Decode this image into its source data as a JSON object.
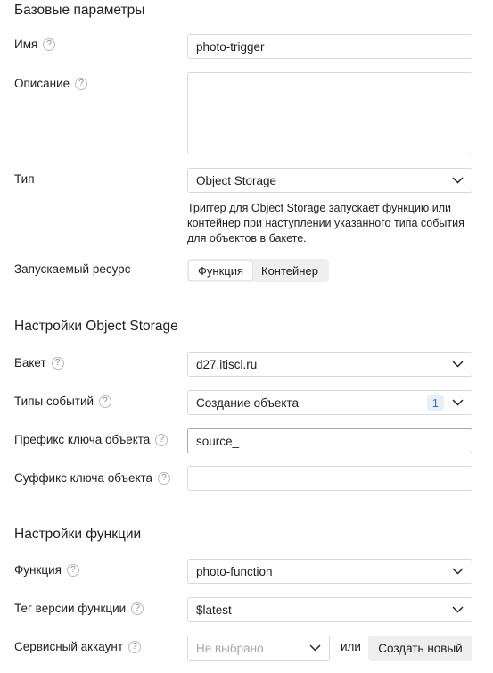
{
  "sections": {
    "basic": "Базовые параметры",
    "storage": "Настройки Object Storage",
    "function": "Настройки функции"
  },
  "help_glyph": "?",
  "name": {
    "label": "Имя",
    "value": "photo-trigger"
  },
  "description": {
    "label": "Описание",
    "value": ""
  },
  "type": {
    "label": "Тип",
    "value": "Object Storage",
    "hint": "Триггер для Object Storage запускает функцию или контейнер при наступлении указанного типа события для объектов в бакете."
  },
  "resource": {
    "label": "Запускаемый ресурс",
    "tabs": [
      "Функция",
      "Контейнер"
    ],
    "active_index": 0
  },
  "bucket": {
    "label": "Бакет",
    "value": "d27.itiscl.ru"
  },
  "event_types": {
    "label": "Типы событий",
    "value": "Создание объекта",
    "count": "1"
  },
  "prefix": {
    "label": "Префикс ключа объекта",
    "value": "source_"
  },
  "suffix": {
    "label": "Суффикс ключа объекта",
    "value": ""
  },
  "function": {
    "label": "Функция",
    "value": "photo-function"
  },
  "version_tag": {
    "label": "Тег версии функции",
    "value": "$latest"
  },
  "service_account": {
    "label": "Сервисный аккаунт",
    "placeholder": "Не выбрано",
    "or_text": "или",
    "create_button": "Создать новый"
  },
  "colors": {
    "border": "#d9d9d9",
    "badge_bg": "#e6f0fb",
    "badge_text": "#2b6ed1",
    "tabs_bg": "#efefef"
  }
}
